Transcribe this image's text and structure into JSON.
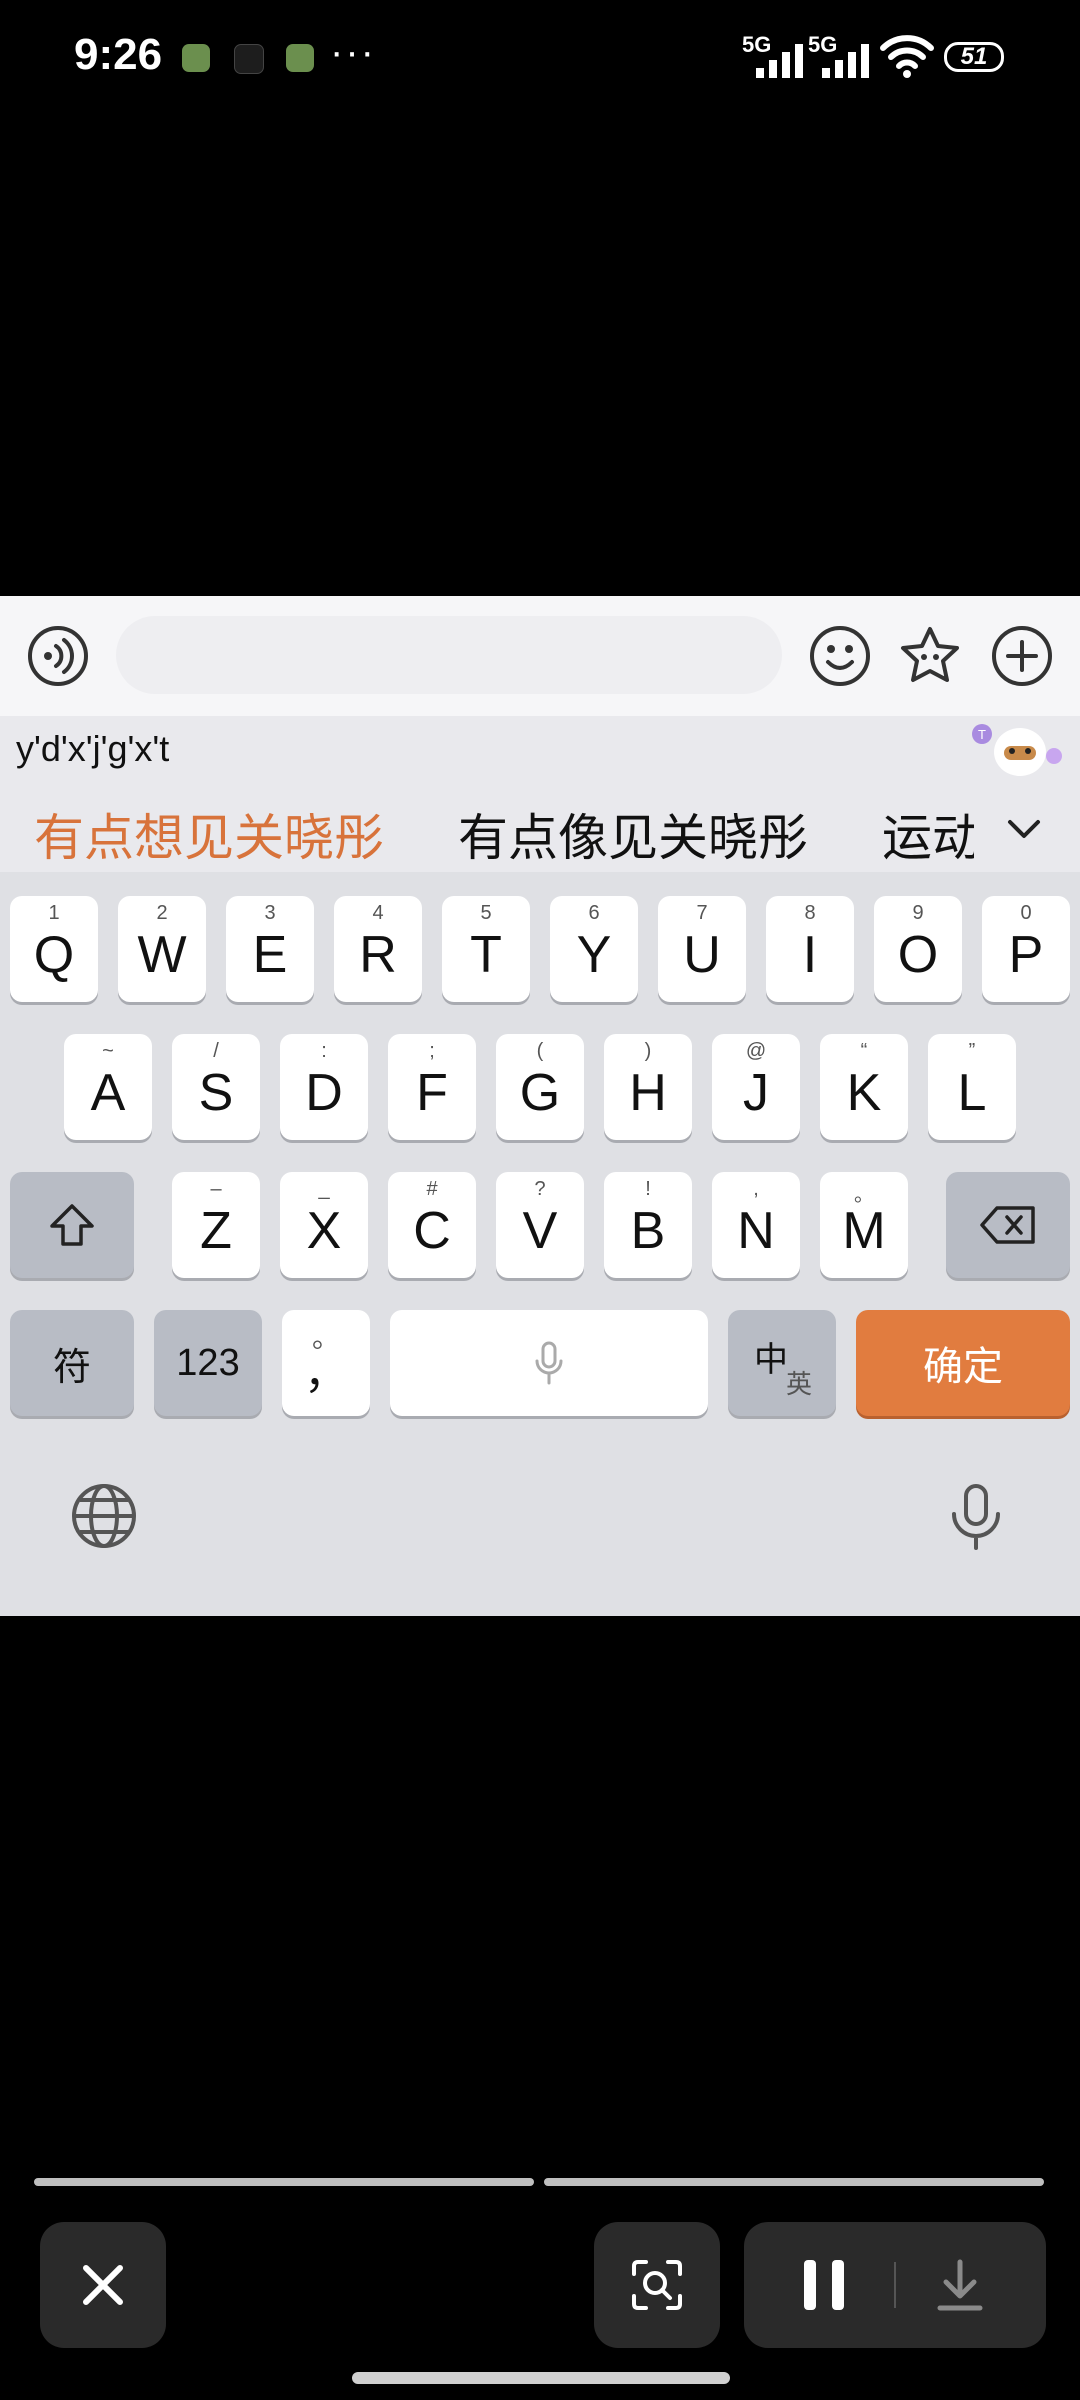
{
  "status_bar": {
    "time": "9:26",
    "more_dots": "···",
    "sim1_label": "5G",
    "sim2_label": "5G",
    "battery": "51"
  },
  "keyboard": {
    "composing_text": "y'd'x'j'g'x't",
    "candidates": [
      "有点想见关晓彤",
      "有点像见关晓彤",
      "运动"
    ],
    "row1": [
      {
        "hint": "1",
        "key": "Q"
      },
      {
        "hint": "2",
        "key": "W"
      },
      {
        "hint": "3",
        "key": "E"
      },
      {
        "hint": "4",
        "key": "R"
      },
      {
        "hint": "5",
        "key": "T"
      },
      {
        "hint": "6",
        "key": "Y"
      },
      {
        "hint": "7",
        "key": "U"
      },
      {
        "hint": "8",
        "key": "I"
      },
      {
        "hint": "9",
        "key": "O"
      },
      {
        "hint": "0",
        "key": "P"
      }
    ],
    "row2": [
      {
        "hint": "~",
        "key": "A"
      },
      {
        "hint": "/",
        "key": "S"
      },
      {
        "hint": ":",
        "key": "D"
      },
      {
        "hint": ";",
        "key": "F"
      },
      {
        "hint": "(",
        "key": "G"
      },
      {
        "hint": ")",
        "key": "H"
      },
      {
        "hint": "@",
        "key": "J"
      },
      {
        "hint": "“",
        "key": "K"
      },
      {
        "hint": "”",
        "key": "L"
      }
    ],
    "row3": [
      {
        "hint": "–",
        "key": "Z"
      },
      {
        "hint": "_",
        "key": "X"
      },
      {
        "hint": "#",
        "key": "C"
      },
      {
        "hint": "?",
        "key": "V"
      },
      {
        "hint": "!",
        "key": "B"
      },
      {
        "hint": ",",
        "key": "N"
      },
      {
        "hint": "。",
        "key": "M"
      }
    ],
    "symbols_label": "符",
    "numbers_label": "123",
    "punct_hint": "。",
    "punct_key": "，",
    "lang_main": "中",
    "lang_sub": "英",
    "confirm_label": "确定",
    "accent_color": "#e17c3f"
  },
  "icons": {
    "toolbar": [
      "voice-wave-icon",
      "emoji-icon",
      "star-skin-icon",
      "plus-icon"
    ],
    "bottom": [
      "globe-icon",
      "microphone-icon"
    ],
    "player": [
      "close-icon",
      "screen-search-icon",
      "pause-icon",
      "download-icon"
    ]
  }
}
